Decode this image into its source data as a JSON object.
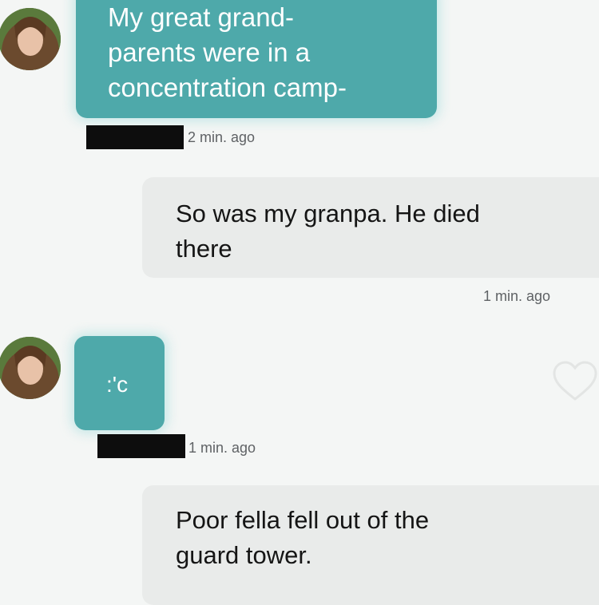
{
  "colors": {
    "incoming_bubble": "#4ea9aa",
    "outgoing_bubble": "#e9ebea",
    "background": "#f4f6f5",
    "redaction": "#0d0d0d"
  },
  "icons": {
    "avatar": "profile-photo-avatar",
    "like": "heart-outline-icon"
  },
  "conversation": {
    "messages": [
      {
        "direction": "incoming",
        "text": "My great grand-\nparents were in a\nconcentration camp-",
        "sender_name": "[redacted]",
        "timestamp": "2 min. ago"
      },
      {
        "direction": "outgoing",
        "text": "So was my granpa. He died\nthere",
        "timestamp": "1 min. ago"
      },
      {
        "direction": "incoming",
        "text": ":'c",
        "sender_name": "[redacted]",
        "timestamp": "1 min. ago",
        "liked": false
      },
      {
        "direction": "outgoing",
        "text": "Poor fella fell out of the\nguard tower."
      }
    ]
  }
}
